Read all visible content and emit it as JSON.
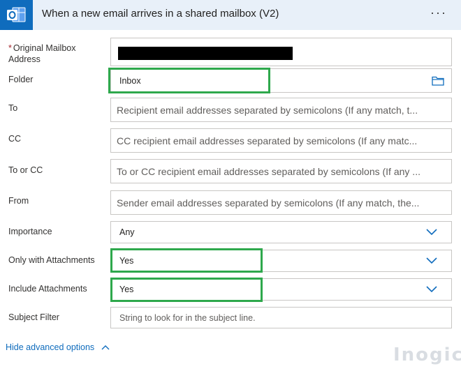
{
  "header": {
    "title": "When a new email arrives in a shared mailbox (V2)",
    "menu_label": "···",
    "accent": "#0f6cbd"
  },
  "fields": {
    "mailbox": {
      "required_mark": "*",
      "label": "Original Mailbox Address"
    },
    "folder": {
      "label": "Folder",
      "value": "Inbox",
      "icon": "folder-icon"
    },
    "to": {
      "label": "To",
      "placeholder": "Recipient email addresses separated by semicolons (If any match, t..."
    },
    "cc": {
      "label": "CC",
      "placeholder": "CC recipient email addresses separated by semicolons (If any matc..."
    },
    "to_or_cc": {
      "label": "To or CC",
      "placeholder": "To or CC recipient email addresses separated by semicolons (If any ..."
    },
    "from": {
      "label": "From",
      "placeholder": "Sender email addresses separated by semicolons (If any match, the..."
    },
    "importance": {
      "label": "Importance",
      "value": "Any"
    },
    "only_attachments": {
      "label": "Only with Attachments",
      "value": "Yes"
    },
    "include_attachments": {
      "label": "Include Attachments",
      "value": "Yes"
    },
    "subject": {
      "label": "Subject Filter",
      "placeholder": "String to look for in the subject line."
    }
  },
  "footer": {
    "advanced_link": "Hide advanced options",
    "watermark": "Inogic"
  },
  "colors": {
    "highlight": "#2ea84c",
    "link": "#0f6cbd",
    "required": "#a4262c"
  }
}
